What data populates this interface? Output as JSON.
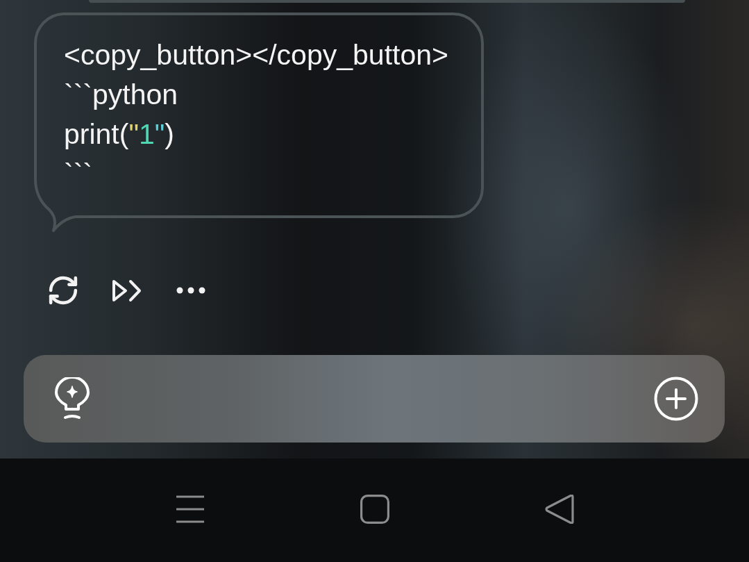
{
  "message": {
    "lines": [
      {
        "tokens": [
          {
            "text": "<copy_button></copy_button>",
            "color": "#f4f4f4"
          }
        ]
      },
      {
        "tokens": [
          {
            "text": "```python",
            "color": "#f4f4f4"
          }
        ]
      },
      {
        "tokens": [
          {
            "text": "print(",
            "color": "#f4f4f4"
          },
          {
            "text": "\"",
            "color": "#e2d36c"
          },
          {
            "text": "1",
            "color": "#4fd6b2"
          },
          {
            "text": "\"",
            "color": "#5ccfd6"
          },
          {
            "text": ")",
            "color": "#f4f4f4"
          }
        ]
      },
      {
        "tokens": [
          {
            "text": "```",
            "color": "#f4f4f4"
          }
        ]
      }
    ]
  },
  "actions": [
    {
      "kind": "regenerate"
    },
    {
      "kind": "continue"
    },
    {
      "kind": "more"
    }
  ],
  "composer": {
    "leading": [
      {
        "kind": "idea"
      }
    ],
    "trailing": [
      {
        "kind": "add"
      }
    ]
  },
  "nav_bar": {
    "buttons": [
      {
        "kind": "recents"
      },
      {
        "kind": "home"
      },
      {
        "kind": "back"
      }
    ]
  }
}
